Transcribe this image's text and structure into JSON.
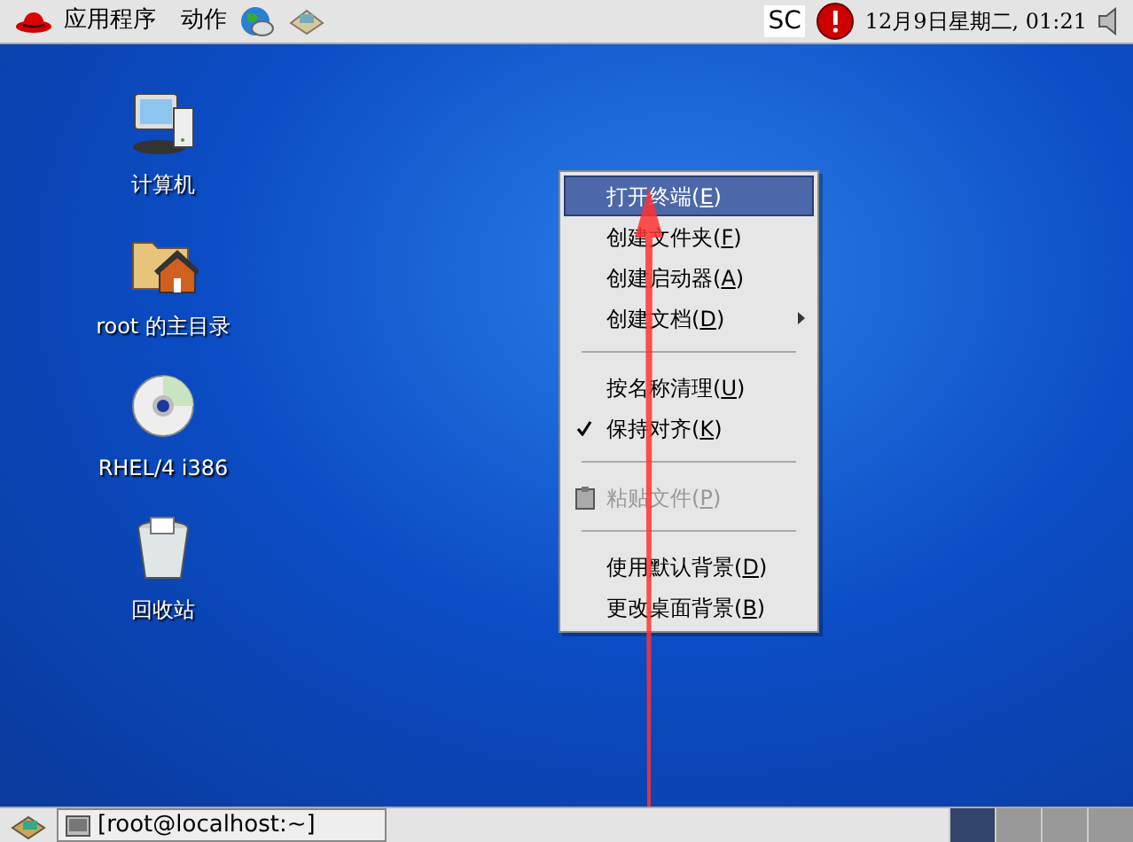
{
  "top_panel": {
    "menus": [
      "应用程序",
      "动作"
    ],
    "tray_label": "SC",
    "clock": "12月9日星期二, 01:21"
  },
  "desktop_icons": [
    {
      "kind": "computer",
      "label": "计算机"
    },
    {
      "kind": "home",
      "label": "root 的主目录"
    },
    {
      "kind": "disc",
      "label": "RHEL/4 i386"
    },
    {
      "kind": "trash",
      "label": "回收站"
    }
  ],
  "context_menu": {
    "items": [
      {
        "kind": "item",
        "text": "打开终端(",
        "accel": "E",
        "tail": ")",
        "selected": true,
        "disabled": false,
        "checked": false,
        "submenu": false
      },
      {
        "kind": "item",
        "text": "创建文件夹(",
        "accel": "F",
        "tail": ")",
        "selected": false,
        "disabled": false,
        "checked": false,
        "submenu": false
      },
      {
        "kind": "item",
        "text": "创建启动器(",
        "accel": "A",
        "tail": ")",
        "selected": false,
        "disabled": false,
        "checked": false,
        "submenu": false
      },
      {
        "kind": "item",
        "text": "创建文档(",
        "accel": "D",
        "tail": ")",
        "selected": false,
        "disabled": false,
        "checked": false,
        "submenu": true
      },
      {
        "kind": "separator"
      },
      {
        "kind": "item",
        "text": "按名称清理(",
        "accel": "U",
        "tail": ")",
        "selected": false,
        "disabled": false,
        "checked": false,
        "submenu": false
      },
      {
        "kind": "item",
        "text": "保持对齐(",
        "accel": "K",
        "tail": ")",
        "selected": false,
        "disabled": false,
        "checked": true,
        "submenu": false
      },
      {
        "kind": "separator"
      },
      {
        "kind": "paste",
        "text": "粘贴文件(",
        "accel": "P",
        "tail": ")",
        "selected": false,
        "disabled": true,
        "checked": false,
        "submenu": false
      },
      {
        "kind": "separator"
      },
      {
        "kind": "item",
        "text": "使用默认背景(",
        "accel": "D",
        "tail": ")",
        "selected": false,
        "disabled": false,
        "checked": false,
        "submenu": false
      },
      {
        "kind": "item",
        "text": "更改桌面背景(",
        "accel": "B",
        "tail": ")",
        "selected": false,
        "disabled": false,
        "checked": false,
        "submenu": false
      }
    ]
  },
  "taskbar": {
    "tasks": [
      {
        "label": "[root@localhost:~]",
        "selected": false
      }
    ],
    "workspaces": [
      {
        "selected": true
      },
      {
        "selected": false
      },
      {
        "selected": false
      },
      {
        "selected": false
      }
    ]
  }
}
